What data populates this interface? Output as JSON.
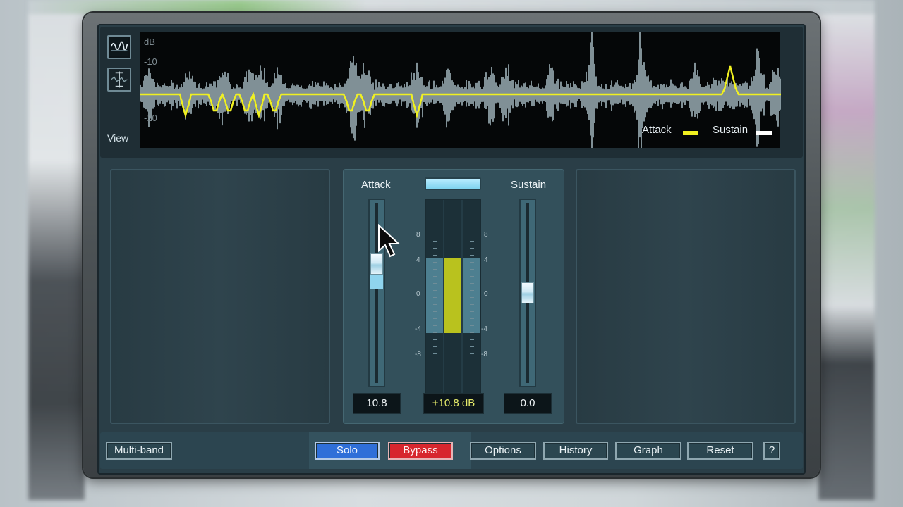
{
  "waveform": {
    "db_label": "dB",
    "db_top": "-10",
    "db_bottom": "-10",
    "view_label": "View",
    "view_buttons": [
      "waveform-view-icon",
      "envelope-view-icon"
    ],
    "legend": [
      {
        "label": "Attack",
        "color": "#f0f020"
      },
      {
        "label": "Sustain",
        "color": "#ffffff"
      }
    ]
  },
  "controls": {
    "attack": {
      "title": "Attack",
      "value": "10.8",
      "level": 0.28
    },
    "output": {
      "value": "+10.8 dB",
      "level": 0.3
    },
    "sustain": {
      "title": "Sustain",
      "value": "0.0",
      "level": 0.5
    },
    "scale": [
      "8",
      "4",
      "0",
      "-4",
      "-8"
    ]
  },
  "toolbar": {
    "multiband": "Multi-band",
    "solo": "Solo",
    "bypass": "Bypass",
    "options": "Options",
    "history": "History",
    "graph": "Graph",
    "reset": "Reset",
    "help": "?"
  },
  "colors": {
    "attack": "#f0f020",
    "sustain": "#ffffff",
    "solo": "#2f6fd8",
    "bypass": "#d7262e",
    "meter_fill": "#b9c21e",
    "accent": "#8fd4ee"
  }
}
